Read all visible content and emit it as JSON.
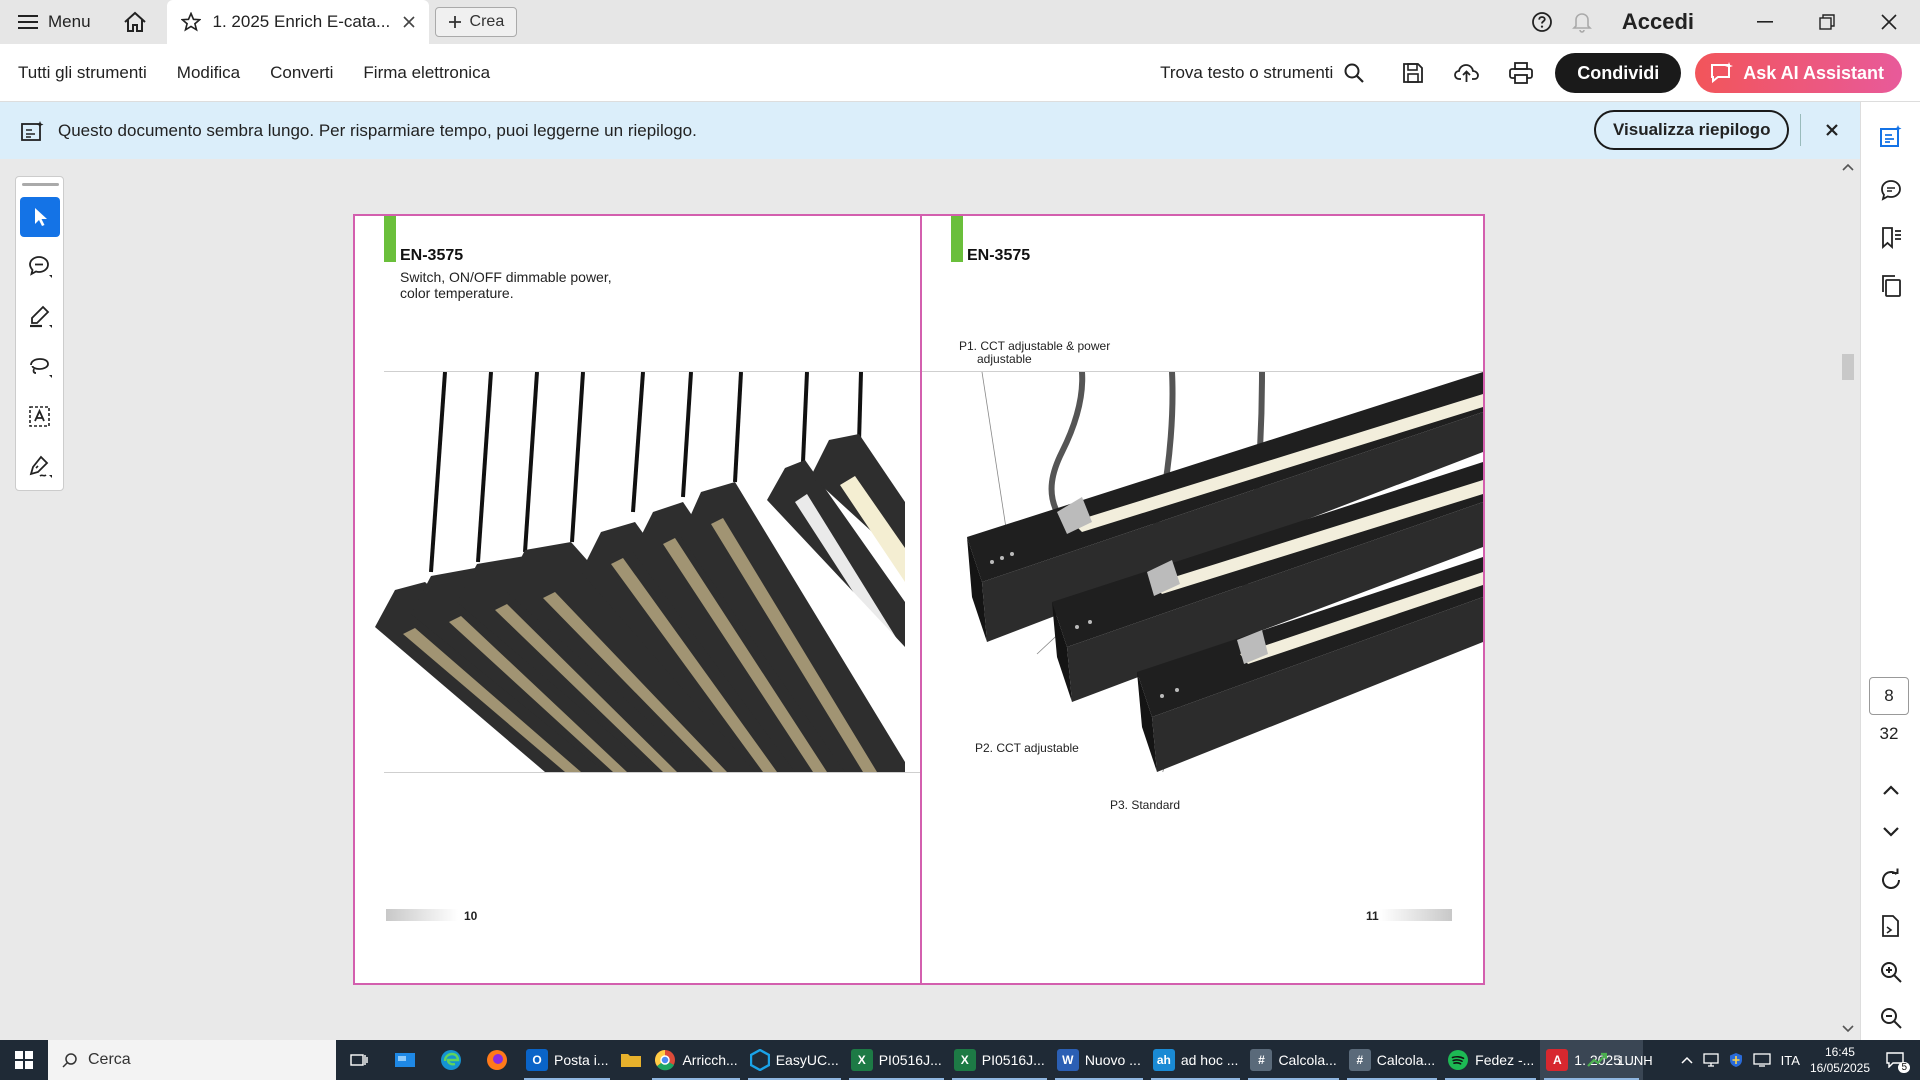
{
  "titlebar": {
    "menu_label": "Menu",
    "tab_title": "1. 2025 Enrich E-cata...",
    "crea_label": "Crea",
    "accedi_label": "Accedi"
  },
  "toolbar": {
    "items": [
      "Tutti gli strumenti",
      "Modifica",
      "Converti",
      "Firma elettronica"
    ],
    "find_label": "Trova testo o strumenti",
    "share_label": "Condividi",
    "ai_label": "Ask AI Assistant"
  },
  "banner": {
    "text": "Questo documento sembra lungo. Per risparmiare tempo, puoi leggerne un riepilogo.",
    "button_label": "Visualizza riepilogo"
  },
  "pager": {
    "current": "8",
    "total": "32"
  },
  "document": {
    "left_page": {
      "code": "EN-3575",
      "description_line1": "Switch, ON/OFF dimmable power,",
      "description_line2": "color temperature.",
      "page_number": "10"
    },
    "right_page": {
      "code": "EN-3575",
      "p1_line1": "P1. CCT adjustable & power",
      "p1_line2": "adjustable",
      "p2": "P2. CCT adjustable",
      "p3": "P3. Standard",
      "page_number": "11"
    }
  },
  "taskbar": {
    "search_label": "Cerca",
    "apps": [
      {
        "name": "outlook",
        "label": "Posta i...",
        "color": "#0a64c8",
        "glyph": "O"
      },
      {
        "name": "explorer",
        "label": "",
        "color": "#e7b12c",
        "glyph": ""
      },
      {
        "name": "chrome",
        "label": "Arricch...",
        "color": "#dd4b39",
        "glyph": ""
      },
      {
        "name": "easyuc",
        "label": "EasyUC...",
        "color": "#1aa3e8",
        "glyph": ""
      },
      {
        "name": "excel1",
        "label": "PI0516J...",
        "color": "#1d7a45",
        "glyph": "X"
      },
      {
        "name": "excel2",
        "label": "PI0516J...",
        "color": "#1d7a45",
        "glyph": "X"
      },
      {
        "name": "word",
        "label": "Nuovo ...",
        "color": "#2b5fb4",
        "glyph": "W"
      },
      {
        "name": "adhoc",
        "label": "ad hoc ...",
        "color": "#1a8ad4",
        "glyph": "ah"
      },
      {
        "name": "calc1",
        "label": "Calcola...",
        "color": "#5a6a7a",
        "glyph": "#"
      },
      {
        "name": "calc2",
        "label": "Calcola...",
        "color": "#5a6a7a",
        "glyph": "#"
      },
      {
        "name": "spotify",
        "label": "Fedez -...",
        "color": "#1db954",
        "glyph": ""
      },
      {
        "name": "acrobat",
        "label": "1. 2025 ...",
        "color": "#d7282f",
        "glyph": "A"
      }
    ],
    "tray_label": "1UNH",
    "language": "ITA",
    "time": "16:45",
    "date": "16/05/2025",
    "notifications": "5"
  }
}
